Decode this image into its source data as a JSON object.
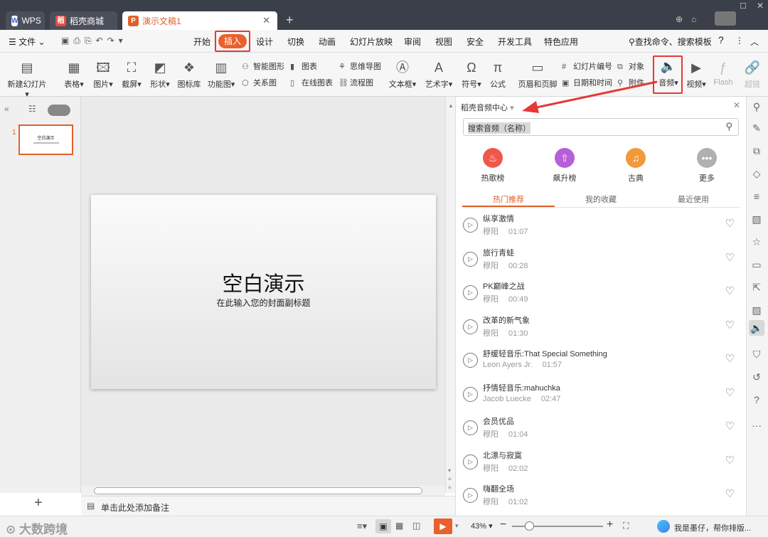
{
  "tabs": [
    {
      "label": "WPS"
    },
    {
      "label": "稻壳商城"
    },
    {
      "label": "演示文稿1"
    }
  ],
  "menu": {
    "file": "文件",
    "items": [
      "开始",
      "插入",
      "设计",
      "切换",
      "动画",
      "幻灯片放映",
      "审阅",
      "视图",
      "安全",
      "开发工具",
      "特色应用"
    ],
    "search": "查找命令、搜索模板"
  },
  "ribbon": {
    "new_slide": "新建幻灯片",
    "table": "表格",
    "picture": "图片",
    "screenshot": "截屏",
    "shape": "形状",
    "icon_lib": "图标库",
    "function_chart": "功能图",
    "smart_shape": "智能图形",
    "chart": "图表",
    "mind_map": "思维导图",
    "relation": "关系图",
    "online_chart": "在线图表",
    "flowchart": "流程图",
    "textbox": "文本框",
    "art_text": "艺术字",
    "symbol": "符号",
    "formula": "公式",
    "header_footer": "页眉和页脚",
    "slide_number": "幻灯片编号",
    "object": "对象",
    "date_time": "日期和时间",
    "attachment": "附件",
    "audio": "音频",
    "video": "视频",
    "flash": "Flash",
    "extra": "超链"
  },
  "slide": {
    "thumb_number": "1",
    "title": "空白演示",
    "subtitle": "在此输入您的封面副标题",
    "notes_placeholder": "单击此处添加备注"
  },
  "panel": {
    "title": "稻壳音频中心",
    "search_placeholder": "搜索音频（名称）",
    "categories": [
      {
        "label": "热歌榜",
        "color": "#f0574a"
      },
      {
        "label": "飙升榜",
        "color": "#b55fd8"
      },
      {
        "label": "古典",
        "color": "#f2993a"
      },
      {
        "label": "更多",
        "color": "#a9a9a9"
      }
    ],
    "subtabs": [
      "热门推荐",
      "我的收藏",
      "最近使用"
    ],
    "songs": [
      {
        "name": "纵享激情",
        "artist": "穆阳",
        "duration": "01:07"
      },
      {
        "name": "旅行青蛙",
        "artist": "穆阳",
        "duration": "00:28"
      },
      {
        "name": "PK巅峰之战",
        "artist": "穆阳",
        "duration": "00:49"
      },
      {
        "name": "改革的新气象",
        "artist": "穆阳",
        "duration": "01:30"
      },
      {
        "name": "舒缓轻音乐:That Special Something",
        "artist": "Leon Ayers Jr.",
        "duration": "01:57"
      },
      {
        "name": "抒情轻音乐:mahuchka",
        "artist": "Jacob Luecke",
        "duration": "02:47"
      },
      {
        "name": "会员优品",
        "artist": "穆阳",
        "duration": "01:04"
      },
      {
        "name": "北漂与寂寞",
        "artist": "穆阳",
        "duration": "02:02"
      },
      {
        "name": "嗨翻全场",
        "artist": "穆阳",
        "duration": "01:02"
      }
    ]
  },
  "status": {
    "zoom": "43%",
    "assistant": "我是墨仔，帮你排版...",
    "watermark": "大数跨境"
  }
}
